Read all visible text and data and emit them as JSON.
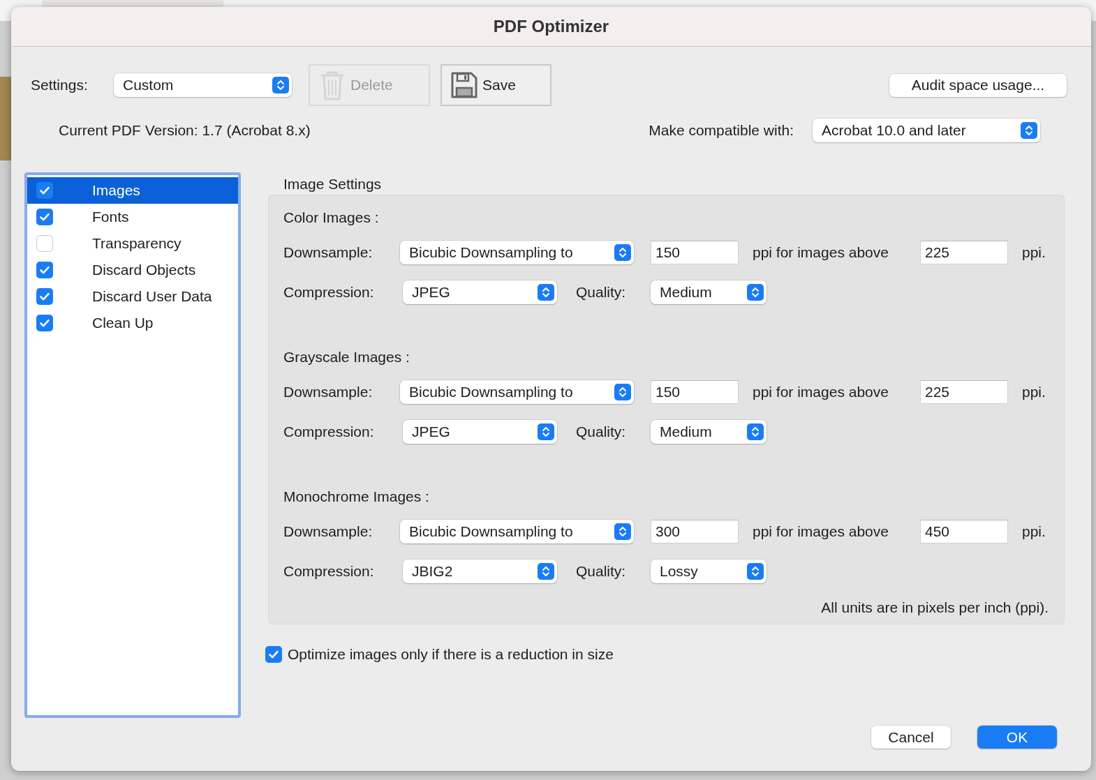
{
  "window": {
    "title": "PDF Optimizer"
  },
  "settings": {
    "label": "Settings:",
    "value": "Custom"
  },
  "buttons": [
    {
      "label": "Delete",
      "disabled": true,
      "kind": "delete"
    },
    {
      "label": "Save",
      "disabled": false,
      "kind": "save"
    }
  ],
  "audit_button": "Audit space usage...",
  "current_version": "Current PDF Version: 1.7 (Acrobat 8.x)",
  "compatibility": {
    "label": "Make compatible with:",
    "value": "Acrobat 10.0 and later"
  },
  "panels": [
    {
      "label": "Images",
      "checked": true,
      "selected": true
    },
    {
      "label": "Fonts",
      "checked": true,
      "selected": false
    },
    {
      "label": "Transparency",
      "checked": false,
      "selected": false
    },
    {
      "label": "Discard Objects",
      "checked": true,
      "selected": false
    },
    {
      "label": "Discard User Data",
      "checked": true,
      "selected": false
    },
    {
      "label": "Clean Up",
      "checked": true,
      "selected": false
    }
  ],
  "image_settings": {
    "title": "Image Settings",
    "groups": [
      {
        "title": "Color Images :",
        "downsample_label": "Downsample:",
        "downsample": "Bicubic Downsampling to",
        "resolution": "150",
        "above_label": "ppi for images above",
        "above": "225",
        "unit": "ppi.",
        "compression_label": "Compression:",
        "compression": "JPEG",
        "quality_label": "Quality:",
        "quality": "Medium"
      },
      {
        "title": "Grayscale Images :",
        "downsample_label": "Downsample:",
        "downsample": "Bicubic Downsampling to",
        "resolution": "150",
        "above_label": "ppi for images above",
        "above": "225",
        "unit": "ppi.",
        "compression_label": "Compression:",
        "compression": "JPEG",
        "quality_label": "Quality:",
        "quality": "Medium"
      },
      {
        "title": "Monochrome Images :",
        "downsample_label": "Downsample:",
        "downsample": "Bicubic Downsampling to",
        "resolution": "300",
        "above_label": "ppi for images above",
        "above": "450",
        "unit": "ppi.",
        "compression_label": "Compression:",
        "compression": "JBIG2",
        "quality_label": "Quality:",
        "quality": "Lossy"
      }
    ],
    "note": "All units are in pixels per inch (ppi)."
  },
  "optimize_only": {
    "label": "Optimize images only if there is a reduction in size",
    "checked": true
  },
  "footer_buttons": [
    {
      "label": "Cancel",
      "default": false
    },
    {
      "label": "OK",
      "default": true
    }
  ]
}
